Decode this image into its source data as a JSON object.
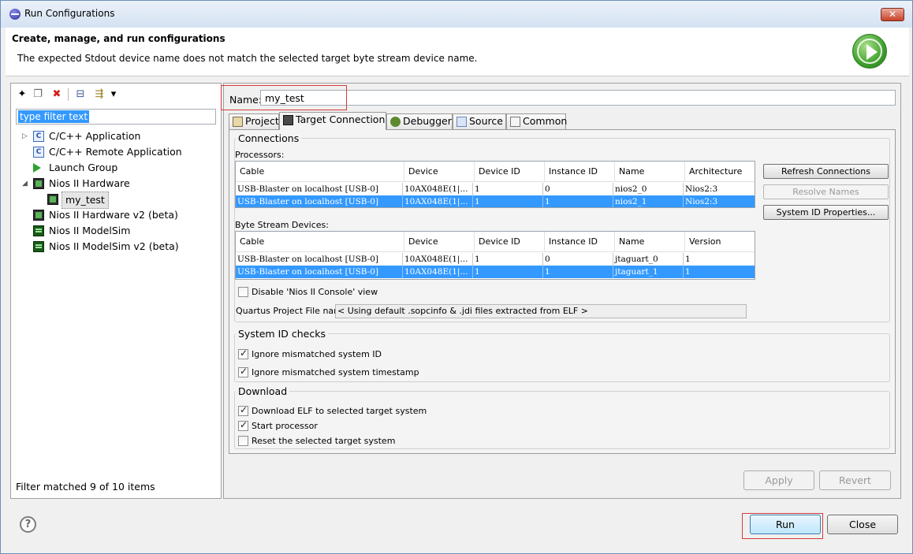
{
  "window": {
    "title": "Run Configurations",
    "close_label": "✕"
  },
  "header": {
    "heading": "Create, manage, and run configurations",
    "message": "The expected Stdout device name does not match the selected target byte stream device name."
  },
  "left": {
    "filter_text": "type filter text",
    "toolbar": {
      "new_icon": "✦",
      "duplicate_icon": "❐",
      "delete_icon": "✖",
      "collapse_icon": "⊟",
      "filter_icon": "⇶",
      "menu_icon": "▾"
    },
    "tree": [
      {
        "label": "C/C++ Application",
        "icon": "c-app-icon",
        "twisty": "▷"
      },
      {
        "label": "C/C++ Remote Application",
        "icon": "c-remote-icon",
        "twisty": ""
      },
      {
        "label": "Launch Group",
        "icon": "launch-group-icon",
        "twisty": ""
      },
      {
        "label": "Nios II Hardware",
        "icon": "nios-hardware-icon",
        "twisty": "◢"
      },
      {
        "label": "my_test",
        "icon": "nios-hardware-icon",
        "twisty": ""
      },
      {
        "label": "Nios II Hardware v2 (beta)",
        "icon": "nios-hardware-icon",
        "twisty": ""
      },
      {
        "label": "Nios II ModelSim",
        "icon": "modelsim-icon",
        "twisty": ""
      },
      {
        "label": "Nios II ModelSim v2 (beta)",
        "icon": "modelsim-icon",
        "twisty": ""
      }
    ],
    "status": "Filter matched 9 of 10 items"
  },
  "right": {
    "name_label": "Name:",
    "name_value": "my_test",
    "tabs": [
      "Project",
      "Target Connection",
      "Debugger",
      "Source",
      "Common"
    ],
    "connections": {
      "title": "Connections",
      "processors_label": "Processors:",
      "processors": {
        "headers": [
          "Cable",
          "Device",
          "Device ID",
          "Instance ID",
          "Name",
          "Architecture"
        ],
        "rows": [
          [
            "USB-Blaster on localhost [USB-0]",
            "10AX048E(1|...",
            "1",
            "0",
            "nios2_0",
            "Nios2:3"
          ],
          [
            "USB-Blaster on localhost [USB-0]",
            "10AX048E(1|...",
            "1",
            "1",
            "nios2_1",
            "Nios2:3"
          ]
        ]
      },
      "bsd_label": "Byte Stream Devices:",
      "bsd": {
        "headers": [
          "Cable",
          "Device",
          "Device ID",
          "Instance ID",
          "Name",
          "Version"
        ],
        "rows": [
          [
            "USB-Blaster on localhost [USB-0]",
            "10AX048E(1|...",
            "1",
            "0",
            "jtaguart_0",
            "1"
          ],
          [
            "USB-Blaster on localhost [USB-0]",
            "10AX048E(1|...",
            "1",
            "1",
            "jtaguart_1",
            "1"
          ]
        ]
      },
      "refresh_label": "Refresh Connections",
      "resolve_label": "Resolve Names",
      "sysid_label": "System ID Properties...",
      "disable_console_label": "Disable 'Nios II Console' view",
      "qpf_label": "Quartus Project File name:",
      "qpf_value": "< Using default .sopcinfo & .jdi files extracted from ELF >"
    },
    "sysid": {
      "title": "System ID checks",
      "ignore_id_label": "Ignore mismatched system ID",
      "ignore_ts_label": "Ignore mismatched system timestamp"
    },
    "download": {
      "title": "Download",
      "download_elf_label": "Download ELF to selected target system",
      "start_label": "Start processor",
      "reset_label": "Reset the selected target system"
    },
    "apply_label": "Apply",
    "revert_label": "Revert"
  },
  "footer": {
    "help_label": "?",
    "run_label": "Run",
    "close_label": "Close"
  }
}
